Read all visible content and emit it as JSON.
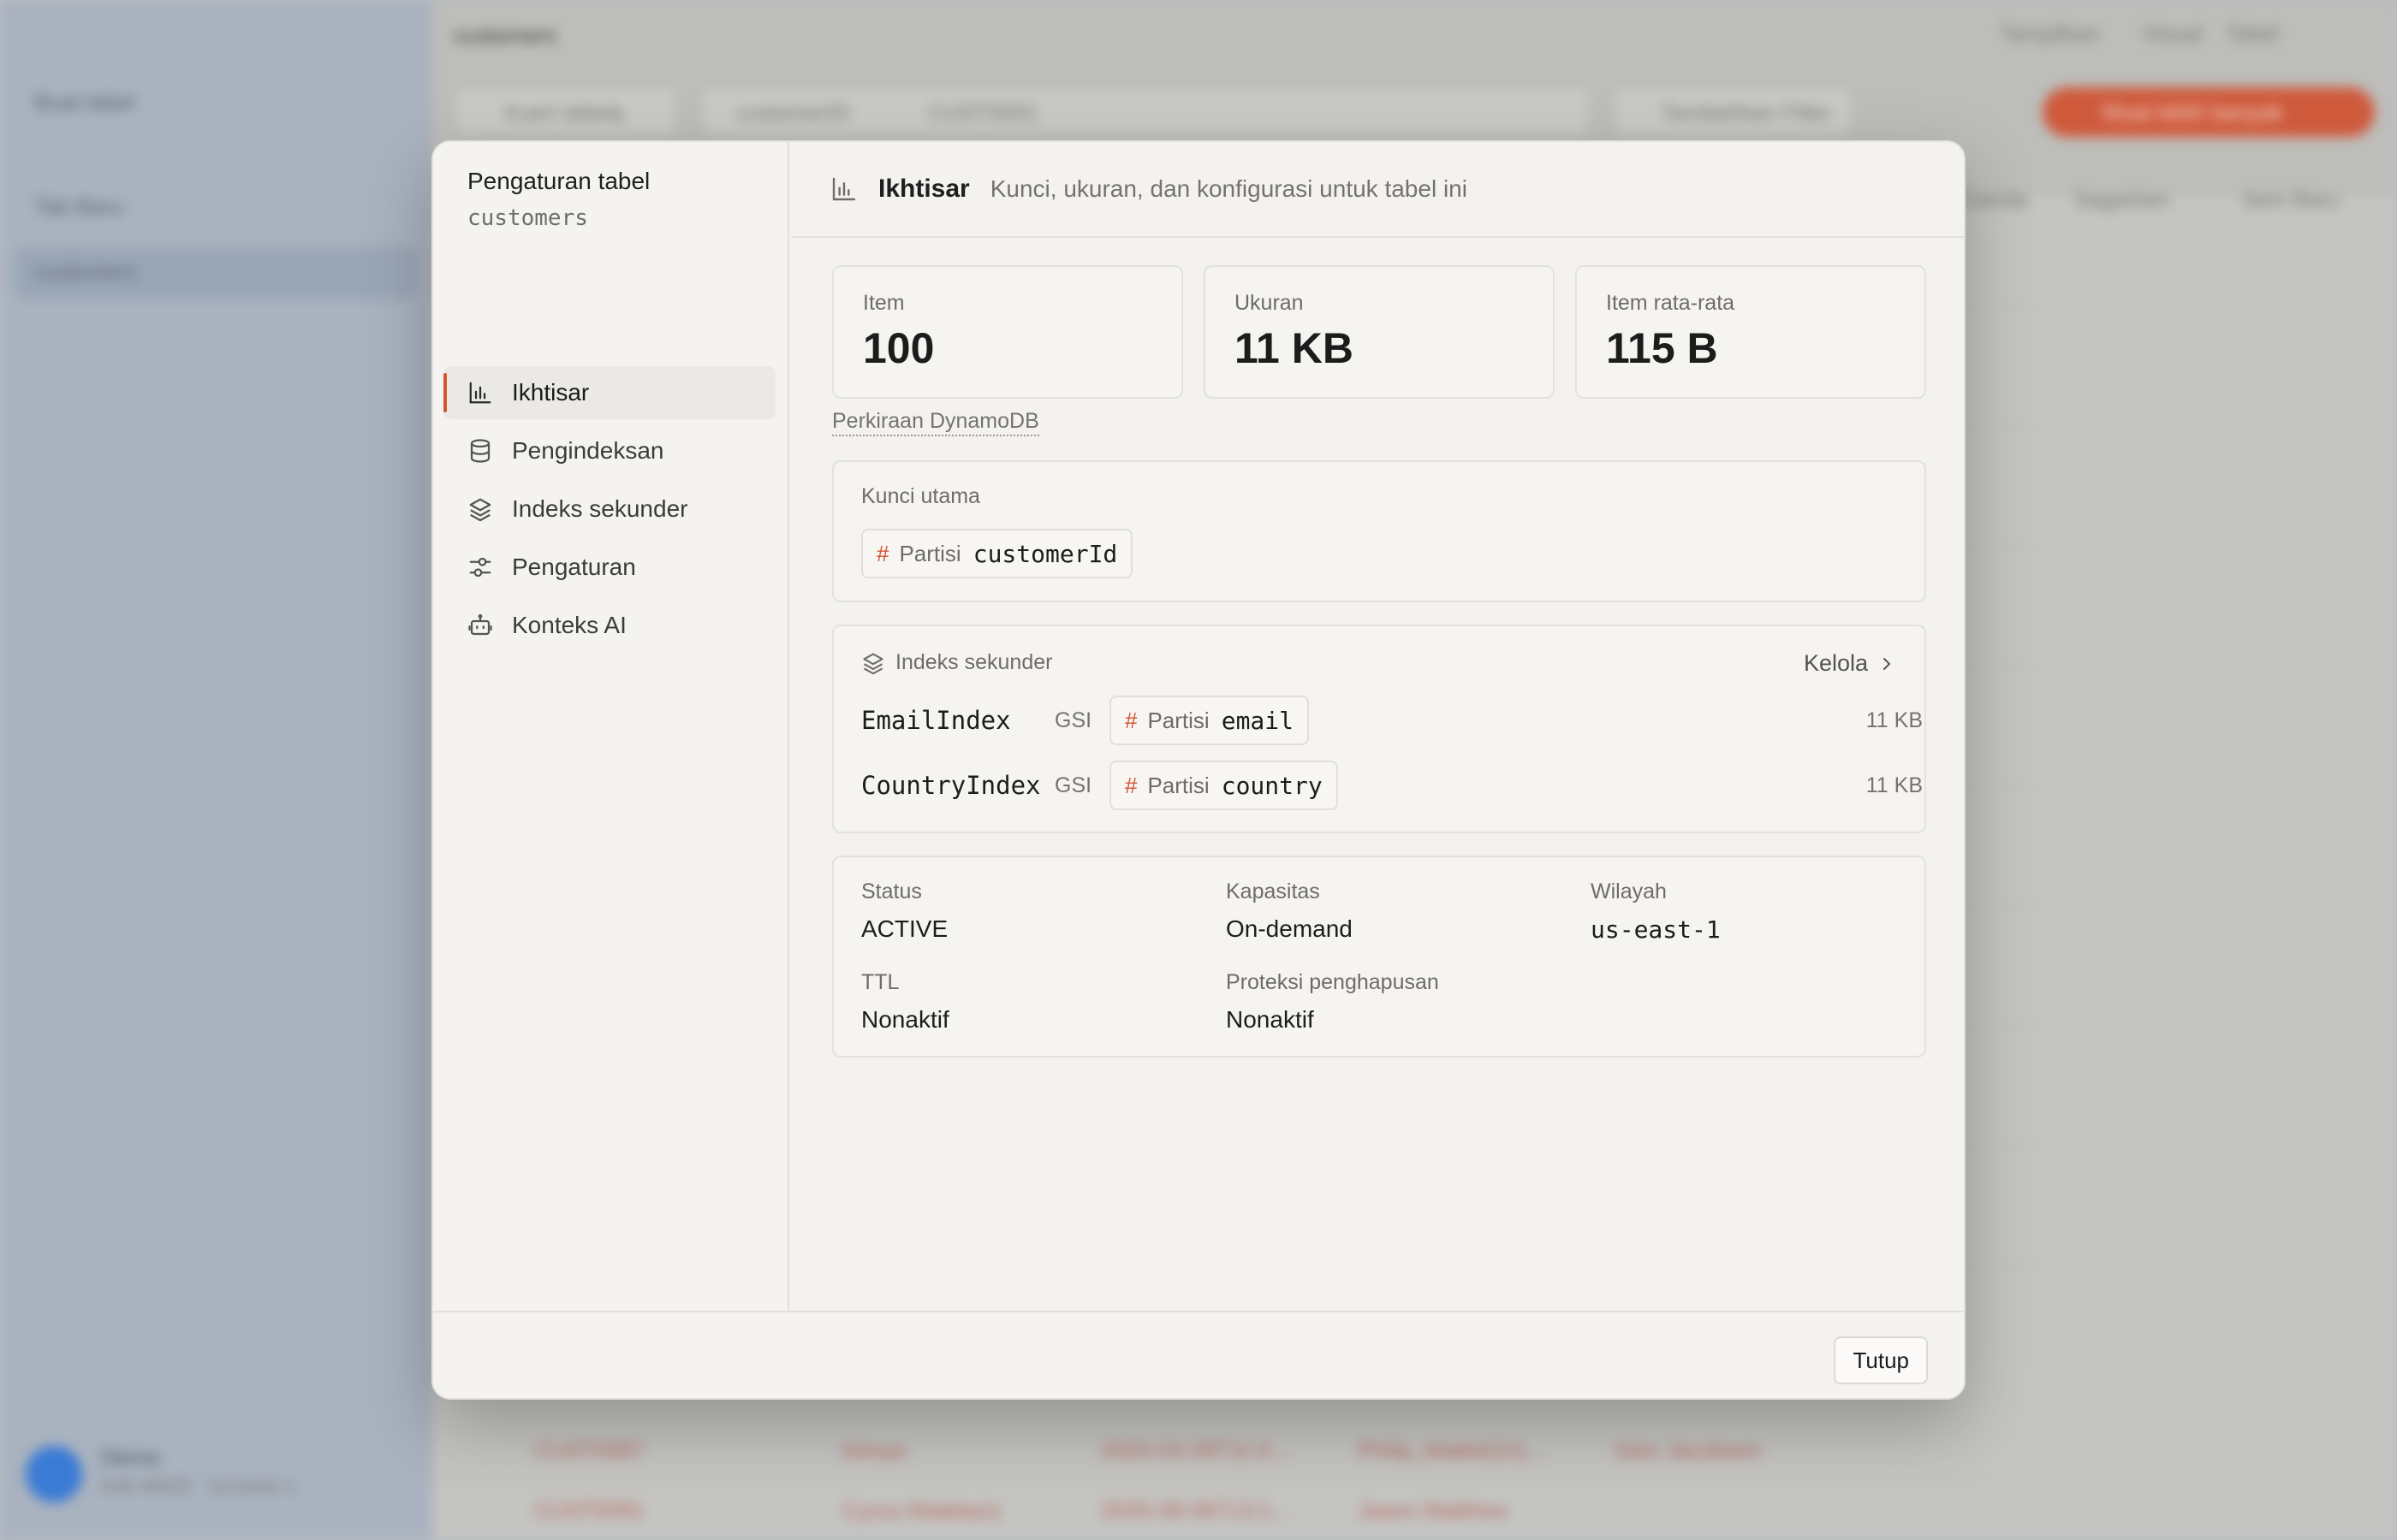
{
  "background": {
    "sidebar_items": [
      "Buat tabel",
      "Tab Baru",
      "customers"
    ],
    "user_name": "Demo",
    "user_sub": "Edit 40025 · 1st team 1",
    "toolbar_title": "customers",
    "filter_chip": "Kueri tabelq",
    "table_chip": "customerID",
    "value_chip": "CUST0001",
    "add_filter": "Tambahkan Filter",
    "run_button": "Muat lebih banyak",
    "right_labels": [
      "Tampilkan",
      "Visual",
      "Tabel"
    ],
    "action_labels": [
      "Ganda",
      "Sagarkan",
      "Item Baru"
    ],
    "row_texts": [
      "CUST0087",
      "Kenya",
      "2025-03-29T11:0...",
      "Philip_Mattel(1h)...",
      "Sam Jacobsen",
      "CUST0091",
      "Cyrus Abdelaziz",
      "2025-08-06T13:1...",
      "Jason Matthew"
    ]
  },
  "dialog": {
    "nav": {
      "title": "Pengaturan tabel",
      "table_name": "customers",
      "items": [
        {
          "label": "Ikhtisar",
          "icon": "bar-chart-icon",
          "active": true
        },
        {
          "label": "Pengindeksan",
          "icon": "database-icon",
          "active": false
        },
        {
          "label": "Indeks sekunder",
          "icon": "layers-icon",
          "active": false
        },
        {
          "label": "Pengaturan",
          "icon": "sliders-icon",
          "active": false
        },
        {
          "label": "Konteks AI",
          "icon": "robot-icon",
          "active": false
        }
      ]
    },
    "header": {
      "title": "Ikhtisar",
      "description": "Kunci, ukuran, dan konfigurasi untuk tabel ini"
    },
    "stats": [
      {
        "label": "Item",
        "value": "100"
      },
      {
        "label": "Ukuran",
        "value": "11 KB"
      },
      {
        "label": "Item rata-rata",
        "value": "115 B"
      }
    ],
    "estimate_link": "Perkiraan DynamoDB",
    "primary_key": {
      "label": "Kunci utama",
      "hash_symbol": "#",
      "kind": "Partisi",
      "attribute": "customerId"
    },
    "secondary_indexes": {
      "label": "Indeks sekunder",
      "manage_label": "Kelola",
      "items": [
        {
          "name": "EmailIndex",
          "type": "GSI",
          "kind": "Partisi",
          "attribute": "email",
          "size": "11 KB"
        },
        {
          "name": "CountryIndex",
          "type": "GSI",
          "kind": "Partisi",
          "attribute": "country",
          "size": "11 KB"
        }
      ]
    },
    "properties": {
      "status_label": "Status",
      "status_value": "ACTIVE",
      "capacity_label": "Kapasitas",
      "capacity_value": "On-demand",
      "region_label": "Wilayah",
      "region_value": "us-east-1",
      "ttl_label": "TTL",
      "ttl_value": "Nonaktif",
      "protection_label": "Proteksi penghapusan",
      "protection_value": "Nonaktif"
    },
    "footer": {
      "close_label": "Tutup"
    }
  },
  "colors": {
    "accent": "#d6532f",
    "dialog_bg": "#f3f2ef",
    "overlay_bg": "#b9bcc2"
  }
}
